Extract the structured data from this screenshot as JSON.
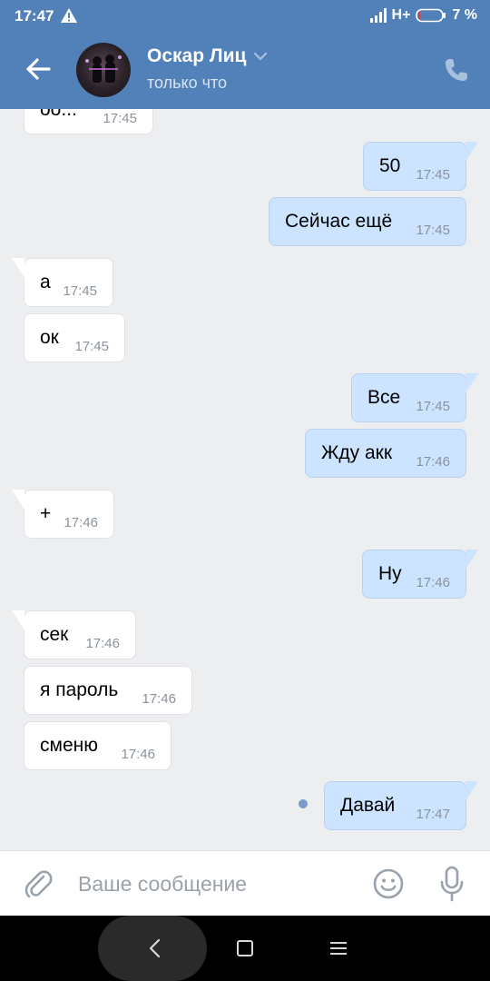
{
  "status_bar": {
    "time": "17:47",
    "network": "H+",
    "battery": "7 %",
    "battery_level": 0.07
  },
  "header": {
    "contact_name": "Оскар Лиц",
    "contact_status": "только что"
  },
  "messages": [
    {
      "text": "50",
      "time": "17:45",
      "direction": "out"
    },
    {
      "text": "Сейчас ещё",
      "time": "17:45",
      "direction": "out"
    },
    {
      "text": "а",
      "time": "17:45",
      "direction": "in"
    },
    {
      "text": "ок",
      "time": "17:45",
      "direction": "in"
    },
    {
      "text": "Все",
      "time": "17:45",
      "direction": "out"
    },
    {
      "text": "Жду акк",
      "time": "17:46",
      "direction": "out"
    },
    {
      "text": "+",
      "time": "17:46",
      "direction": "in"
    },
    {
      "text": "Ну",
      "time": "17:46",
      "direction": "out"
    },
    {
      "text": "сек",
      "time": "17:46",
      "direction": "in"
    },
    {
      "text": "я пароль",
      "time": "17:46",
      "direction": "in"
    },
    {
      "text": "сменю",
      "time": "17:46",
      "direction": "in"
    },
    {
      "text": "Давай",
      "time": "17:47",
      "direction": "out",
      "unread": true
    }
  ],
  "partial_top_message": {
    "text": "оо...",
    "time": "17:45",
    "direction": "in"
  },
  "composer": {
    "placeholder": "Ваше сообщение"
  },
  "colors": {
    "header_blue": "#5181b8",
    "chat_bg": "#edeef0",
    "outgoing_bubble": "#cce4ff",
    "incoming_bubble": "#ffffff",
    "timestamp": "#8a929b",
    "icon_gray": "#99a2ad"
  },
  "icons": [
    "warning-icon",
    "signal-icon",
    "battery-icon",
    "back-arrow-icon",
    "chevron-down-icon",
    "phone-icon",
    "paperclip-icon",
    "emoji-icon",
    "microphone-icon",
    "nav-back-icon",
    "nav-home-icon",
    "nav-menu-icon"
  ]
}
